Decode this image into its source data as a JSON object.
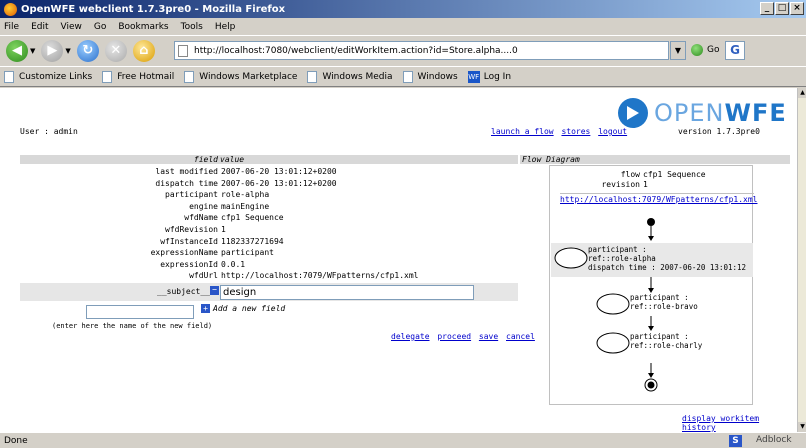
{
  "window": {
    "title": "OpenWFE webclient 1.7.3pre0 - Mozilla Firefox"
  },
  "menu": [
    "File",
    "Edit",
    "View",
    "Go",
    "Bookmarks",
    "Tools",
    "Help"
  ],
  "nav": {
    "url": "http://localhost:7080/webclient/editWorkItem.action?id=Store.alpha....0",
    "go_label": "Go"
  },
  "bookmarks": [
    "Customize Links",
    "Free Hotmail",
    "Windows Marketplace",
    "Windows Media",
    "Windows",
    "Log In"
  ],
  "page": {
    "logo": {
      "light": "OPEN",
      "bold": "WFE"
    },
    "user_label": "User : admin",
    "links": [
      "launch a flow",
      "stores",
      "logout"
    ],
    "version": "version 1.7.3pre0",
    "field_header": {
      "key": "field",
      "value": "value"
    },
    "fields": [
      {
        "key": "last modified",
        "value": "2007-06-20 13:01:12+0200"
      },
      {
        "key": "dispatch time",
        "value": "2007-06-20 13:01:12+0200"
      },
      {
        "key": "participant",
        "value": "role-alpha"
      },
      {
        "key": "engine",
        "value": "mainEngine"
      },
      {
        "key": "wfdName",
        "value": "cfp1 Sequence"
      },
      {
        "key": "wfdRevision",
        "value": "1"
      },
      {
        "key": "wfInstanceId",
        "value": "1182337271694"
      },
      {
        "key": "expressionName",
        "value": "participant"
      },
      {
        "key": "expressionId",
        "value": "0.0.1"
      },
      {
        "key": "wfdUrl",
        "value": "http://localhost:7079/WFpatterns/cfp1.xml"
      }
    ],
    "subject": {
      "key": "__subject__",
      "value": "design"
    },
    "add_field": "Add a new field",
    "new_field_hint": "(enter here the name of the new field)",
    "actions": [
      "delegate",
      "proceed",
      "save",
      "cancel"
    ],
    "flow_header": "Flow Diagram",
    "flow": {
      "flow_label": "flow",
      "flow_value": "cfp1 Sequence",
      "revision_label": "revision",
      "revision_value": "1",
      "url": "http://localhost:7079/WFpatterns/cfp1.xml",
      "nodes": [
        {
          "line1": "participant :",
          "line2": "ref::role-alpha",
          "line3": "dispatch time : 2007-06-20 13:01:12",
          "active": true
        },
        {
          "line1": "participant :",
          "line2": "ref::role-bravo",
          "line3": "",
          "active": false
        },
        {
          "line1": "participant :",
          "line2": "ref::role-charly",
          "line3": "",
          "active": false
        }
      ]
    },
    "history_link": "display workitem history"
  },
  "status": {
    "text": "Done",
    "adblock": "Adblock"
  }
}
